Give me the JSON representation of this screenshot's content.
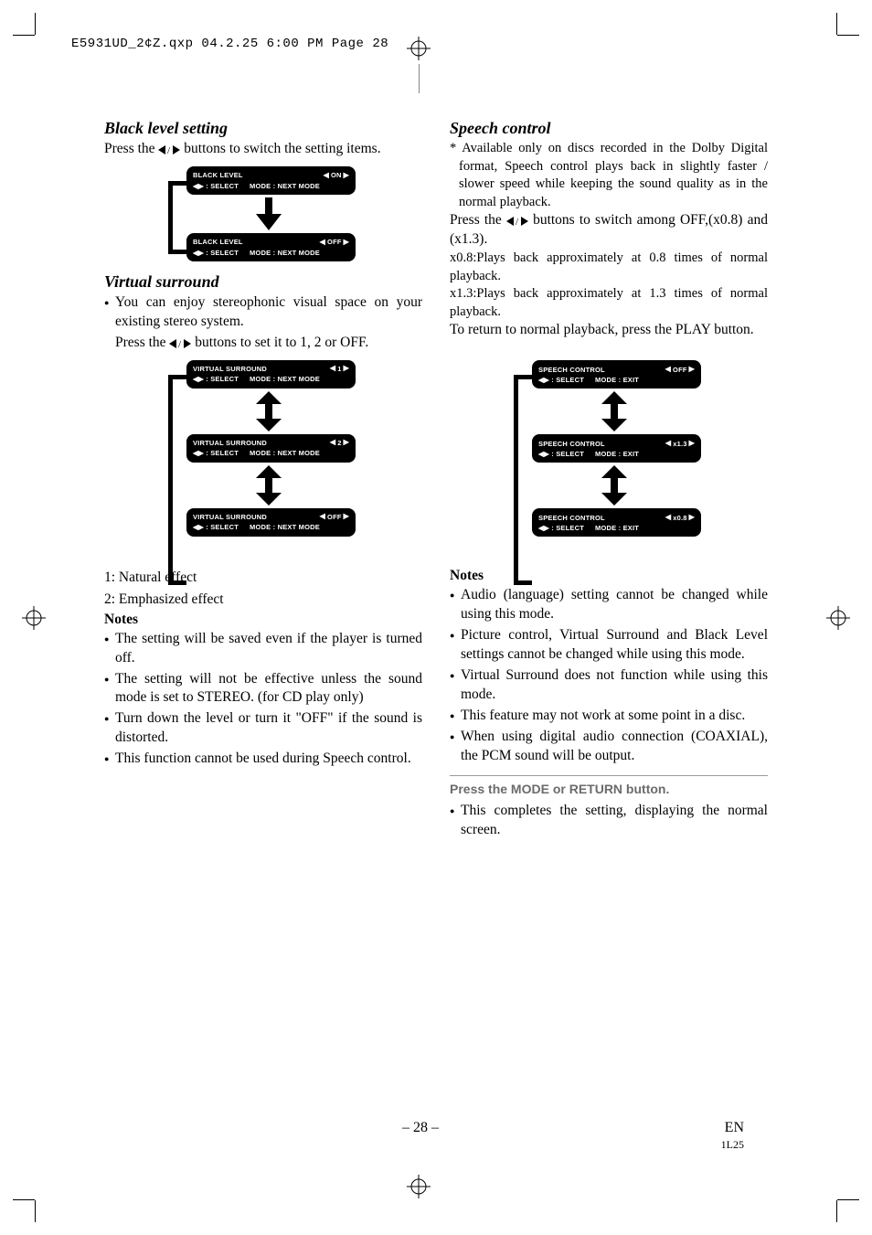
{
  "header": "E5931UD_2¢Z.qxp  04.2.25  6:00 PM  Page 28",
  "left": {
    "h1": "Black level setting",
    "p1a": "Press the ",
    "p1b": " buttons to switch the setting items.",
    "osd1": {
      "title": "BLACK LEVEL",
      "val": "ON",
      "row2a": ": SELECT",
      "row2b": "MODE : NEXT MODE"
    },
    "osd2": {
      "title": "BLACK LEVEL",
      "val": "OFF",
      "row2a": ": SELECT",
      "row2b": "MODE : NEXT MODE"
    },
    "h2": "Virtual surround",
    "vs_b1": "You can enjoy stereophonic visual space on your existing stereo system.",
    "vs_p1a": "Press the ",
    "vs_p1b": " buttons to set it to 1, 2 or OFF.",
    "vosd1": {
      "title": "VIRTUAL SURROUND",
      "val": "1",
      "row2a": ": SELECT",
      "row2b": "MODE : NEXT MODE"
    },
    "vosd2": {
      "title": "VIRTUAL SURROUND",
      "val": "2",
      "row2a": ": SELECT",
      "row2b": "MODE : NEXT MODE"
    },
    "vosd3": {
      "title": "VIRTUAL SURROUND",
      "val": "OFF",
      "row2a": ": SELECT",
      "row2b": "MODE : NEXT MODE"
    },
    "legend1": "1: Natural effect",
    "legend2": "2: Emphasized effect",
    "notes_title": "Notes",
    "n1": "The setting will be saved even if the player is turned off.",
    "n2": "The setting will not be effective unless the sound mode is set to STEREO. (for CD play only)",
    "n3": "Turn down the level or turn it \"OFF\" if the sound is distorted.",
    "n4": "This function cannot be used during Speech control."
  },
  "right": {
    "h1": "Speech control",
    "foot": "* Available only on discs recorded in the Dolby Digital format, Speech control plays back in slightly faster / slower speed while keeping the sound quality as in the normal playback.",
    "p1a": "Press the ",
    "p1b": " buttons to switch among OFF,(x0.8) and (x1.3).",
    "l1": "x0.8:Plays back approximately at 0.8 times of normal playback.",
    "l2": "x1.3:Plays back approximately at 1.3 times of normal playback.",
    "l3": "To return to normal playback, press the PLAY button.",
    "sosd1": {
      "title": "SPEECH CONTROL",
      "val": "OFF",
      "row2a": ": SELECT",
      "row2b": "MODE : EXIT"
    },
    "sosd2": {
      "title": "SPEECH CONTROL",
      "val": "x1.3",
      "row2a": ": SELECT",
      "row2b": "MODE : EXIT"
    },
    "sosd3": {
      "title": "SPEECH CONTROL",
      "val": "x0.8",
      "row2a": ": SELECT",
      "row2b": "MODE : EXIT"
    },
    "notes_title": "Notes",
    "n1": "Audio (language) setting cannot be changed while using this mode.",
    "n2": "Picture control, Virtual Surround and Black Level settings cannot be changed while using this mode.",
    "n3": "Virtual Surround does not function while using this mode.",
    "n4": "This feature may not work at some point in a disc.",
    "n5": "When using digital audio connection (COAXIAL), the PCM sound will be output.",
    "step": "Press the MODE or RETURN button.",
    "fin": "This completes the setting, displaying the normal screen."
  },
  "footer": {
    "pagenum": "– 28 –",
    "lang": "EN",
    "code": "1L25"
  }
}
